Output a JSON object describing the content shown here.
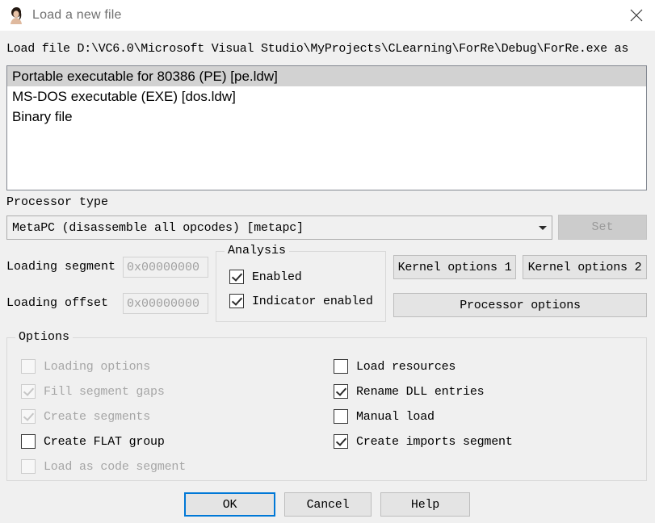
{
  "window": {
    "title": "Load a new file",
    "icon": "ida-lady-icon",
    "close_icon": "close-icon"
  },
  "path_line": {
    "text": "Load file D:\\VC6.0\\Microsoft Visual Studio\\MyProjects\\CLearning\\ForRe\\Debug\\ForRe.exe as"
  },
  "format_list": {
    "items": [
      {
        "label": "Portable executable for 80386 (PE) [pe.ldw]",
        "selected": true
      },
      {
        "label": "MS-DOS executable (EXE) [dos.ldw]",
        "selected": false
      },
      {
        "label": "Binary file",
        "selected": false
      }
    ]
  },
  "processor": {
    "label": "Processor type",
    "value": "MetaPC (disassemble all opcodes)  [metapc]",
    "dropdown_icon": "chevron-down-icon",
    "set_label": "Set"
  },
  "loading": {
    "segment_label": "Loading segment",
    "segment_value": "0x00000000",
    "offset_label": "Loading offset",
    "offset_value": "0x00000000"
  },
  "analysis": {
    "title": "Analysis",
    "items": [
      {
        "label": "Enabled",
        "checked": true,
        "disabled": false
      },
      {
        "label": "Indicator enabled",
        "checked": true,
        "disabled": false
      }
    ]
  },
  "side_buttons": {
    "kernel1": "Kernel options 1",
    "kernel2": "Kernel options 2",
    "processor_options": "Processor options"
  },
  "options": {
    "title": "Options",
    "left": [
      {
        "label": "Loading options",
        "checked": false,
        "disabled": true
      },
      {
        "label": "Fill segment gaps",
        "checked": true,
        "disabled": true
      },
      {
        "label": "Create segments",
        "checked": true,
        "disabled": true
      },
      {
        "label": "Create FLAT group",
        "checked": false,
        "disabled": false
      },
      {
        "label": "Load as code segment",
        "checked": false,
        "disabled": true
      }
    ],
    "right": [
      {
        "label": "Load resources",
        "checked": false,
        "disabled": false
      },
      {
        "label": "Rename DLL entries",
        "checked": true,
        "disabled": false
      },
      {
        "label": "Manual load",
        "checked": false,
        "disabled": false
      },
      {
        "label": "Create imports segment",
        "checked": true,
        "disabled": false
      }
    ]
  },
  "footer": {
    "ok": "OK",
    "cancel": "Cancel",
    "help": "Help"
  },
  "colors": {
    "dialog_background": "#f0f0f0",
    "titlebar_background": "#ffffff",
    "selection": "#d2d2d2",
    "focus_accent": "#0078d7",
    "disabled_text": "#a6a6a6"
  }
}
